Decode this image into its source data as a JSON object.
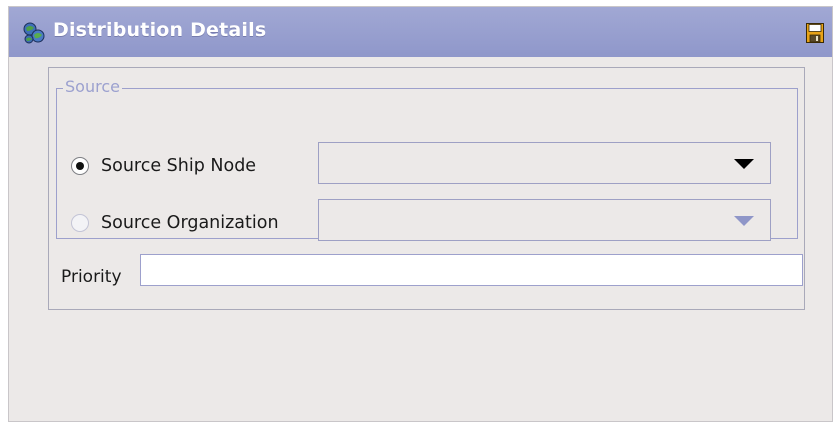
{
  "header": {
    "title": "Distribution Details",
    "title_icon": "network-globe-icon",
    "save_icon": "save-disk-icon"
  },
  "source_group": {
    "legend": "Source",
    "options": [
      {
        "label": "Source Ship Node",
        "selected": true,
        "combo_value": "",
        "combo_enabled": true
      },
      {
        "label": "Source Organization",
        "selected": false,
        "combo_value": "",
        "combo_enabled": false
      }
    ]
  },
  "priority": {
    "label": "Priority",
    "value": ""
  },
  "colors": {
    "title_bar": "#959dce",
    "panel_bg": "#ece9e8",
    "group_border": "#9da0cc",
    "legend_text": "#9ca1cf"
  }
}
